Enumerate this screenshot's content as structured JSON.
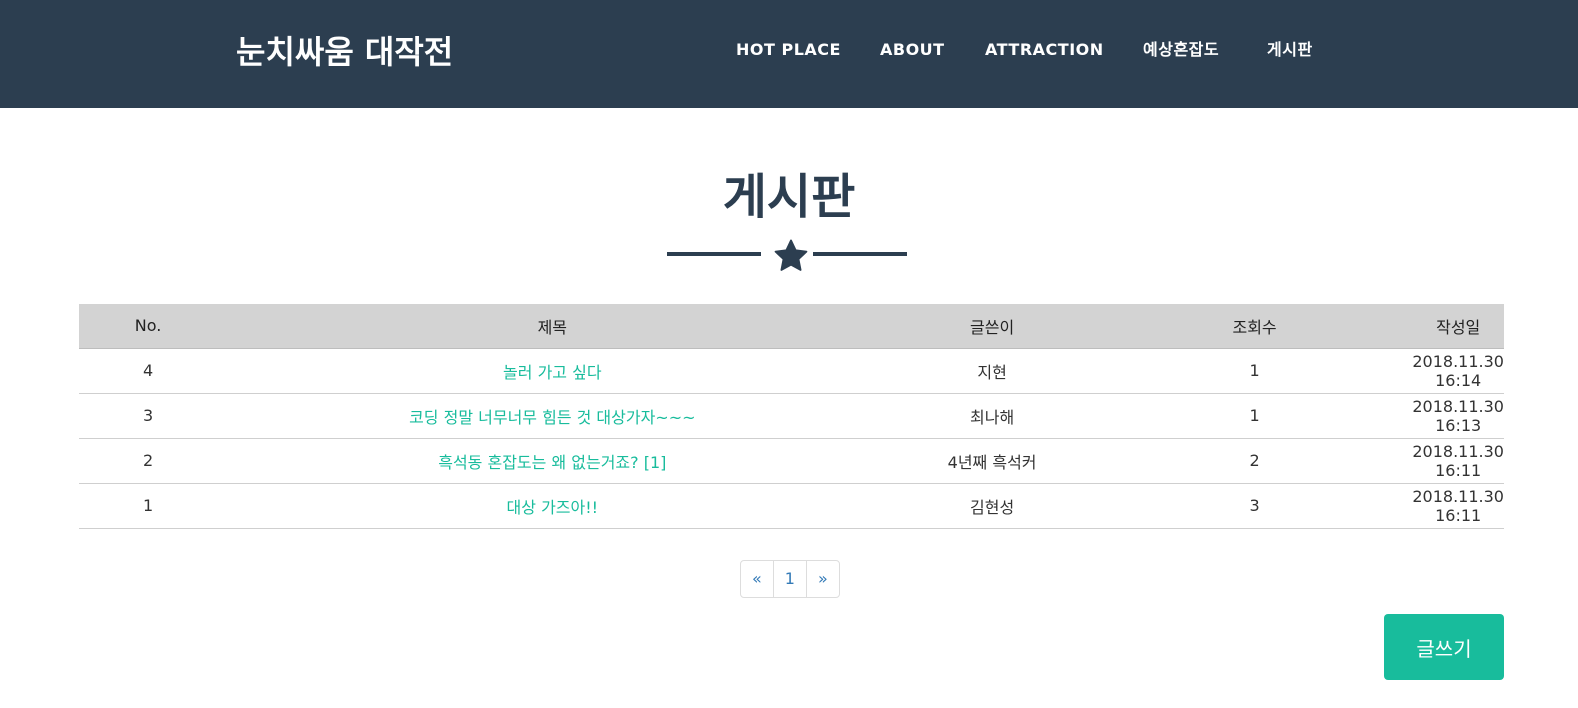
{
  "navbar": {
    "brand": "눈치싸움 대작전",
    "links": [
      "HOT PLACE",
      "ABOUT",
      "ATTRACTION",
      "예상혼잡도",
      "게시판"
    ]
  },
  "page": {
    "title": "게시판",
    "divider_icon": "star-icon"
  },
  "board": {
    "columns": [
      "No.",
      "제목",
      "글쓴이",
      "조회수",
      "작성일"
    ],
    "rows": [
      {
        "no": "4",
        "title": "놀러 가고 싶다",
        "author": "지현",
        "views": "1",
        "date": "2018.11.30 16:14"
      },
      {
        "no": "3",
        "title": "코딩 정말 너무너무 힘든 것 대상가자~~~",
        "author": "최나해",
        "views": "1",
        "date": "2018.11.30 16:13"
      },
      {
        "no": "2",
        "title": "흑석동 혼잡도는 왜 없는거죠? [1]",
        "author": "4년째 흑석커",
        "views": "2",
        "date": "2018.11.30 16:11"
      },
      {
        "no": "1",
        "title": "대상 가즈아!!",
        "author": "김현성",
        "views": "3",
        "date": "2018.11.30 16:11"
      }
    ]
  },
  "pagination": {
    "prev": "«",
    "pages": [
      "1"
    ],
    "next": "»"
  },
  "actions": {
    "write_label": "글쓰기"
  },
  "colors": {
    "navbar": "#2c3e50",
    "accent": "#18bc9c",
    "header_row": "#d3d3d3",
    "link": "#337ab7"
  }
}
